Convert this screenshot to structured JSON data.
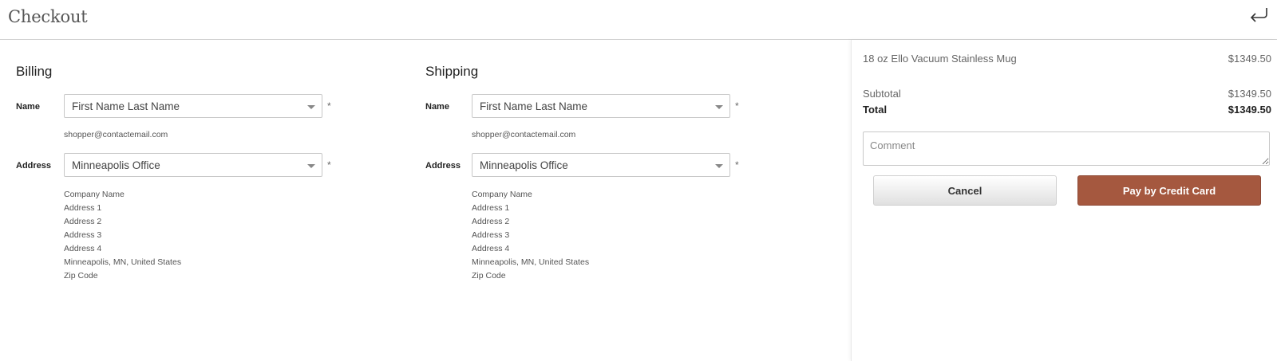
{
  "header": {
    "title": "Checkout",
    "back_icon": "return-arrow-icon"
  },
  "billing": {
    "title": "Billing",
    "name_label": "Name",
    "name_value": "First Name Last Name",
    "email": "shopper@contactemail.com",
    "address_label": "Address",
    "address_value": "Minneapolis Office",
    "required_mark": "*",
    "address_lines": [
      "Company Name",
      "Address 1",
      "Address 2",
      "Address 3",
      "Address 4",
      "Minneapolis, MN, United States",
      "Zip Code"
    ]
  },
  "shipping": {
    "title": "Shipping",
    "name_label": "Name",
    "name_value": "First Name Last Name",
    "email": "shopper@contactemail.com",
    "address_label": "Address",
    "address_value": "Minneapolis Office",
    "required_mark": "*",
    "address_lines": [
      "Company Name",
      "Address 1",
      "Address 2",
      "Address 3",
      "Address 4",
      "Minneapolis, MN, United States",
      "Zip Code"
    ]
  },
  "summary": {
    "item_name": "18 oz Ello Vacuum Stainless Mug",
    "item_price": "$1349.50",
    "subtotal_label": "Subtotal",
    "subtotal_value": "$1349.50",
    "total_label": "Total",
    "total_value": "$1349.50",
    "comment_placeholder": "Comment",
    "cancel_label": "Cancel",
    "pay_label": "Pay by Credit Card",
    "pay_color": "#a5583f"
  }
}
